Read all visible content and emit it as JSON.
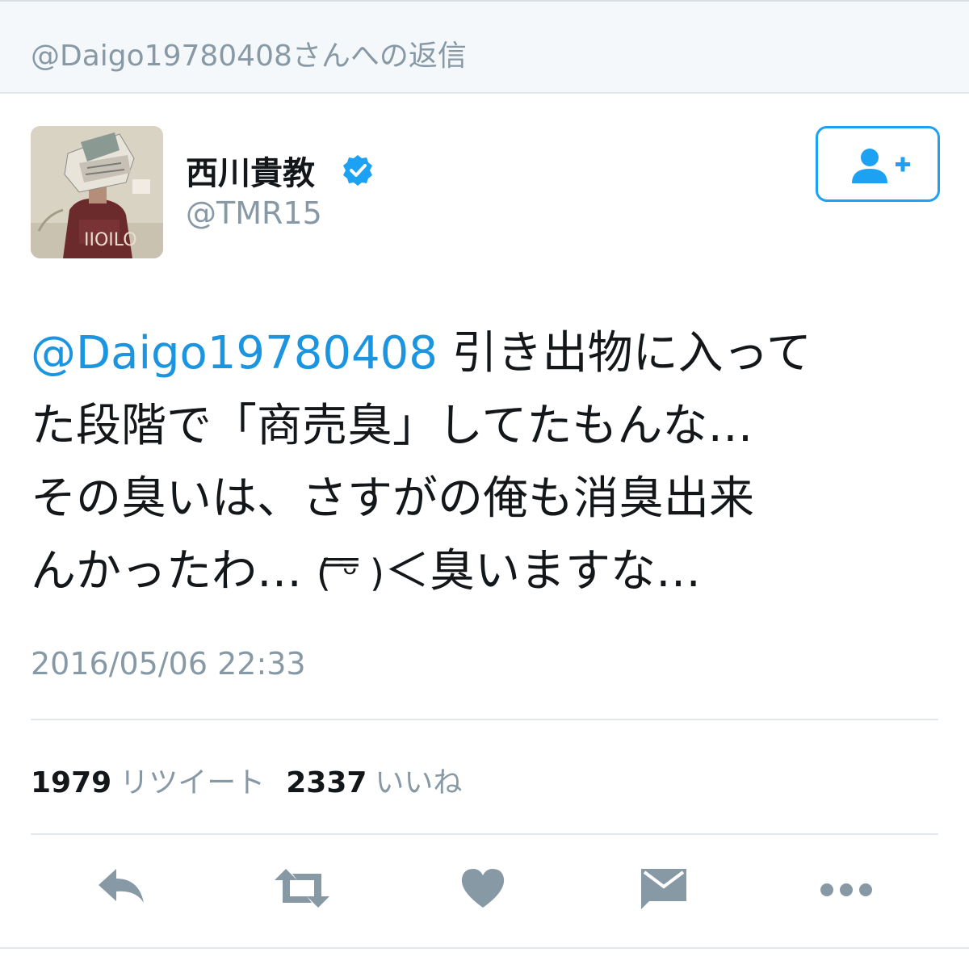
{
  "reply_context": {
    "text": "@Daigo19780408さんへの返信"
  },
  "user": {
    "display_name": "西川貴教",
    "username": "@TMR15",
    "verified_icon": "verified-badge-icon",
    "avatar_icon": "profile-avatar"
  },
  "follow": {
    "icon": "add-user-icon"
  },
  "tweet": {
    "mention": "@Daigo19780408",
    "line1_rest": " 引き出物に入って",
    "line2": "た段階で「商売臭」してたもんな…",
    "line3": "その臭いは、さすがの俺も消臭出来",
    "line4_a": "んかったわ… ",
    "line4_kaomoji": "( ̿ᵕ̿ )",
    "line4_b": "＜臭いますな…"
  },
  "timestamp": "2016/05/06 22:33",
  "stats": {
    "retweet_count": "1979",
    "retweet_label": "リツイート",
    "like_count": "2337",
    "like_label": "いいね"
  },
  "actions": [
    {
      "name": "reply",
      "icon": "reply-icon"
    },
    {
      "name": "retweet",
      "icon": "retweet-icon"
    },
    {
      "name": "like",
      "icon": "heart-icon"
    },
    {
      "name": "direct-message",
      "icon": "envelope-icon"
    },
    {
      "name": "more",
      "icon": "more-icon"
    }
  ],
  "colors": {
    "accent": "#1da1f2",
    "mention": "#1b95e0",
    "muted": "#8899a6",
    "icon": "#8899a6",
    "text": "#14171a"
  }
}
